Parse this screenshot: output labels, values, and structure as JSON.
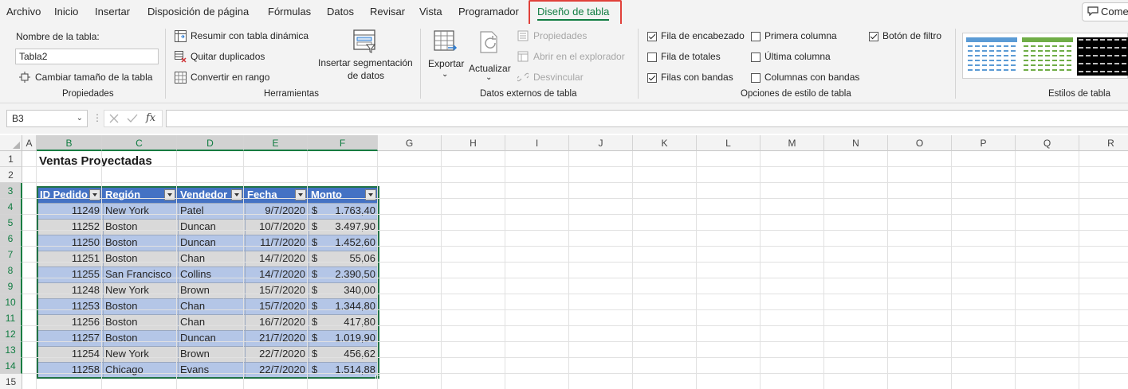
{
  "menu": {
    "tabs": [
      "Archivo",
      "Inicio",
      "Insertar",
      "Disposición de página",
      "Fórmulas",
      "Datos",
      "Revisar",
      "Vista",
      "Programador",
      "Diseño de tabla"
    ],
    "active_tab": "Diseño de tabla",
    "comments_label": "Come"
  },
  "ribbon": {
    "propiedades": {
      "name_label": "Nombre de la tabla:",
      "name_value": "Tabla2",
      "resize_label": "Cambiar tamaño de la tabla",
      "group_label": "Propiedades"
    },
    "herramientas": {
      "pivot_label": "Resumir con tabla dinámica",
      "remove_dup_label": "Quitar duplicados",
      "convert_label": "Convertir en rango",
      "slicer_label_1": "Insertar segmentación",
      "slicer_label_2": "de datos",
      "group_label": "Herramientas"
    },
    "datos_externos": {
      "export_label": "Exportar",
      "refresh_label": "Actualizar",
      "properties_label": "Propiedades",
      "open_browser_label": "Abrir en el explorador",
      "unlink_label": "Desvincular",
      "group_label": "Datos externos de tabla"
    },
    "opciones_estilo": {
      "header_row": {
        "label": "Fila de encabezado",
        "checked": true
      },
      "total_row": {
        "label": "Fila de totales",
        "checked": false
      },
      "banded_rows": {
        "label": "Filas con bandas",
        "checked": true
      },
      "first_column": {
        "label": "Primera columna",
        "checked": false
      },
      "last_column": {
        "label": "Última columna",
        "checked": false
      },
      "banded_columns": {
        "label": "Columnas con bandas",
        "checked": false
      },
      "filter_button": {
        "label": "Botón de filtro",
        "checked": true
      },
      "group_label": "Opciones de estilo de tabla"
    },
    "estilos": {
      "group_label": "Estilos de tabla"
    }
  },
  "formula_bar": {
    "name_box": "B3",
    "fx_symbol": "fx",
    "formula": ""
  },
  "sheet": {
    "columns": [
      "A",
      "B",
      "C",
      "D",
      "E",
      "F",
      "G",
      "H",
      "I",
      "J",
      "K",
      "L",
      "M",
      "N",
      "O",
      "P",
      "Q",
      "R"
    ],
    "rows": [
      "1",
      "2",
      "3",
      "4",
      "5",
      "6",
      "7",
      "8",
      "9",
      "10",
      "11",
      "12",
      "13",
      "14",
      "15"
    ],
    "title": "Ventas Proyectadas",
    "table": {
      "headers": [
        "ID Pedido",
        "Región",
        "Vendedor",
        "Fecha",
        "Monto"
      ],
      "currency_symbol": "$",
      "rows": [
        [
          "11249",
          "New York",
          "Patel",
          "9/7/2020",
          "1.763,40"
        ],
        [
          "11252",
          "Boston",
          "Duncan",
          "10/7/2020",
          "3.497,90"
        ],
        [
          "11250",
          "Boston",
          "Duncan",
          "11/7/2020",
          "1.452,60"
        ],
        [
          "11251",
          "Boston",
          "Chan",
          "14/7/2020",
          "55,06"
        ],
        [
          "11255",
          "San Francisco",
          "Collins",
          "14/7/2020",
          "2.390,50"
        ],
        [
          "11248",
          "New York",
          "Brown",
          "15/7/2020",
          "340,00"
        ],
        [
          "11253",
          "Boston",
          "Chan",
          "15/7/2020",
          "1.344,80"
        ],
        [
          "11256",
          "Boston",
          "Chan",
          "16/7/2020",
          "417,80"
        ],
        [
          "11257",
          "Boston",
          "Duncan",
          "21/7/2020",
          "1.019,90"
        ],
        [
          "11254",
          "New York",
          "Brown",
          "22/7/2020",
          "456,62"
        ],
        [
          "11258",
          "Chicago",
          "Evans",
          "22/7/2020",
          "1.514,88"
        ]
      ]
    }
  },
  "colors": {
    "accent_green": "#107c41",
    "table_header": "#4472c4",
    "band_blue": "#b4c6e7",
    "band_gray": "#d9d9d9",
    "highlight_red": "#e0403a"
  }
}
